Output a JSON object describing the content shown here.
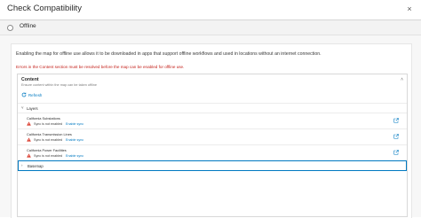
{
  "dialog": {
    "title": "Check Compatibility",
    "close_glyph": "×"
  },
  "tab": {
    "label": "Offline",
    "selected": false
  },
  "main": {
    "intro": "Enabling the map for offline use allows it to be downloaded in apps that support offline workflows and used in locations without an internet connection.",
    "error": "Errors in the Content section must be resolved before the map can be enabled for offline use."
  },
  "content": {
    "title": "Content",
    "subtitle": "Ensure content within the map can be taken offline",
    "collapse_glyph": "˄",
    "refresh_label": "Refresh",
    "layers_label": "Layers",
    "layers_chevron": "˅",
    "layers": [
      {
        "name": "California Substations",
        "status": "Sync is not enabled",
        "action": "Enable sync"
      },
      {
        "name": "California Transmission Lines",
        "status": "Sync is not enabled",
        "action": "Enable sync"
      },
      {
        "name": "California Power Facilities",
        "status": "Sync is not enabled",
        "action": "Enable sync"
      }
    ],
    "basemap_label": "Basemap",
    "basemap_chevron": "›"
  },
  "colors": {
    "accent": "#0079c1",
    "error": "#c4211b",
    "warning": "#d83020"
  },
  "icons": [
    "close-icon",
    "refresh-icon",
    "chevron-down-icon",
    "chevron-up-icon",
    "warning-icon",
    "open-in-new-icon",
    "chevron-right-icon"
  ]
}
